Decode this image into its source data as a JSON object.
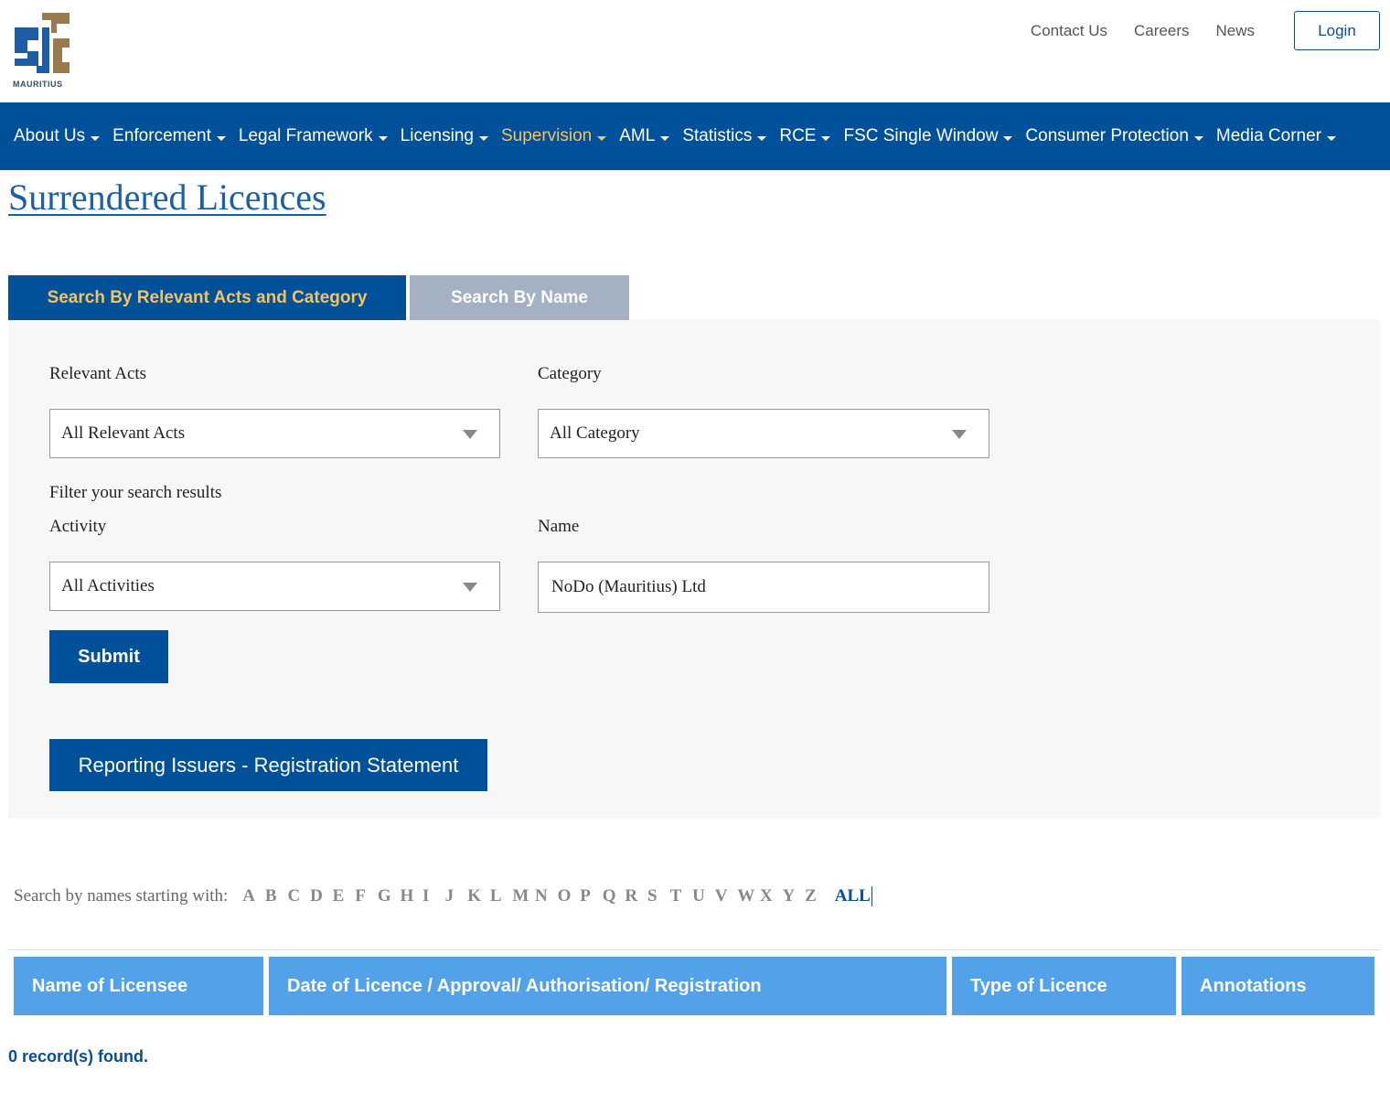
{
  "header": {
    "logo_text": "MAURITIUS",
    "top_links": [
      "Contact Us",
      "Careers",
      "News"
    ],
    "login_label": "Login"
  },
  "nav": {
    "items": [
      {
        "label": "About Us"
      },
      {
        "label": "Enforcement"
      },
      {
        "label": "Legal Framework"
      },
      {
        "label": "Licensing"
      },
      {
        "label": "Supervision",
        "active": true
      },
      {
        "label": "AML"
      },
      {
        "label": "Statistics"
      },
      {
        "label": "RCE"
      },
      {
        "label": "FSC Single Window"
      },
      {
        "label": "Consumer Protection"
      },
      {
        "label": "Media Corner"
      }
    ]
  },
  "page": {
    "title": "Surrendered Licences"
  },
  "tabs": {
    "acts": "Search By Relevant Acts and Category",
    "name": "Search By Name"
  },
  "form": {
    "relevant_acts_label": "Relevant Acts",
    "relevant_acts_value": "All Relevant Acts",
    "category_label": "Category",
    "category_value": "All Category",
    "filter_label": "Filter your search results",
    "activity_label": "Activity",
    "activity_value": "All Activities",
    "name_label": "Name",
    "name_value": "NoDo (Mauritius) Ltd",
    "submit_label": "Submit",
    "reporting_label": "Reporting Issuers - Registration Statement"
  },
  "alphabet": {
    "label": "Search by names starting with:",
    "letters": [
      "A",
      "B",
      "C",
      "D",
      "E",
      "F",
      "G",
      "H",
      "I",
      "J",
      "K",
      "L",
      "M",
      "N",
      "O",
      "P",
      "Q",
      "R",
      "S",
      "T",
      "U",
      "V",
      "W",
      "X",
      "Y",
      "Z"
    ],
    "all_label": "ALL"
  },
  "table": {
    "headers": [
      "Name of Licensee",
      "Date of Licence / Approval/ Authorisation/ Registration",
      "Type of Licence",
      "Annotations"
    ],
    "records_text": "0 record(s) found."
  },
  "colors": {
    "primary": "#00509a",
    "accent": "#f4c35d",
    "table_header": "#53a1e8",
    "inactive_tab": "#a3b1c2"
  }
}
